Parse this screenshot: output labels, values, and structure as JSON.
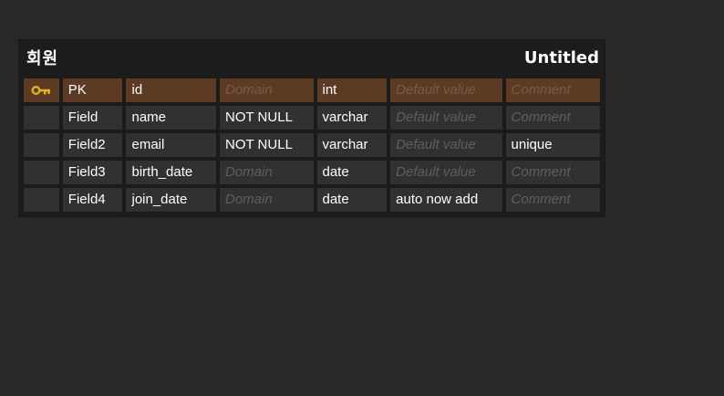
{
  "entity": {
    "name": "회원",
    "schema": "Untitled"
  },
  "columns": [
    {
      "flag": "PK",
      "name": "id",
      "domain": "",
      "type": "int",
      "default": "",
      "comment": "",
      "primary_key": true
    },
    {
      "flag": "Field",
      "name": "name",
      "domain": "NOT NULL",
      "type": "varchar",
      "default": "",
      "comment": "",
      "primary_key": false
    },
    {
      "flag": "Field2",
      "name": "email",
      "domain": "NOT NULL",
      "type": "varchar",
      "default": "",
      "comment": "unique",
      "primary_key": false
    },
    {
      "flag": "Field3",
      "name": "birth_date",
      "domain": "",
      "type": "date",
      "default": "",
      "comment": "",
      "primary_key": false
    },
    {
      "flag": "Field4",
      "name": "join_date",
      "domain": "",
      "type": "date",
      "default": "auto now add",
      "comment": "",
      "primary_key": false
    }
  ],
  "placeholders": {
    "domain": "Domain",
    "default": "Default value",
    "comment": "Comment"
  },
  "icons": {
    "primary_key": "key-icon"
  },
  "colors": {
    "background": "#282828",
    "pk_row": "#5c3a24",
    "key_icon": "#e0b31f"
  }
}
